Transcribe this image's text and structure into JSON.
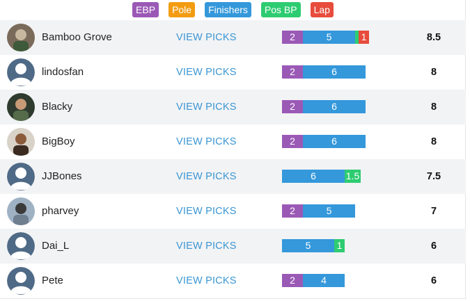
{
  "legend": [
    {
      "label": "EBP",
      "color": "#9b59b6"
    },
    {
      "label": "Pole",
      "color": "#f39c12"
    },
    {
      "label": "Finishers",
      "color": "#3498db"
    },
    {
      "label": "Pos BP",
      "color": "#2ecc71"
    },
    {
      "label": "Lap",
      "color": "#e74c3c"
    }
  ],
  "view_picks_label": "VIEW PICKS",
  "rows": [
    {
      "name": "Bamboo Grove",
      "avatar": "photo",
      "score": "8.5",
      "points": {
        "ebp": "2",
        "finishers": "5",
        "pos_bp": "",
        "lap": "1"
      }
    },
    {
      "name": "lindosfan",
      "avatar": "default",
      "score": "8",
      "points": {
        "ebp": "2",
        "finishers": "6"
      }
    },
    {
      "name": "Blacky",
      "avatar": "photo",
      "score": "8",
      "points": {
        "ebp": "2",
        "finishers": "6"
      }
    },
    {
      "name": "BigBoy",
      "avatar": "photo",
      "score": "8",
      "points": {
        "ebp": "2",
        "finishers": "6"
      }
    },
    {
      "name": "JJBones",
      "avatar": "default",
      "score": "7.5",
      "points": {
        "finishers": "6",
        "pos_bp": "1.5"
      }
    },
    {
      "name": "pharvey",
      "avatar": "photo",
      "score": "7",
      "points": {
        "ebp": "2",
        "finishers": "5"
      }
    },
    {
      "name": "Dai_L",
      "avatar": "default",
      "score": "6",
      "points": {
        "finishers": "5",
        "pos_bp": "1"
      }
    },
    {
      "name": "Pete",
      "avatar": "default",
      "score": "6",
      "points": {
        "ebp": "2",
        "finishers": "4"
      }
    }
  ]
}
